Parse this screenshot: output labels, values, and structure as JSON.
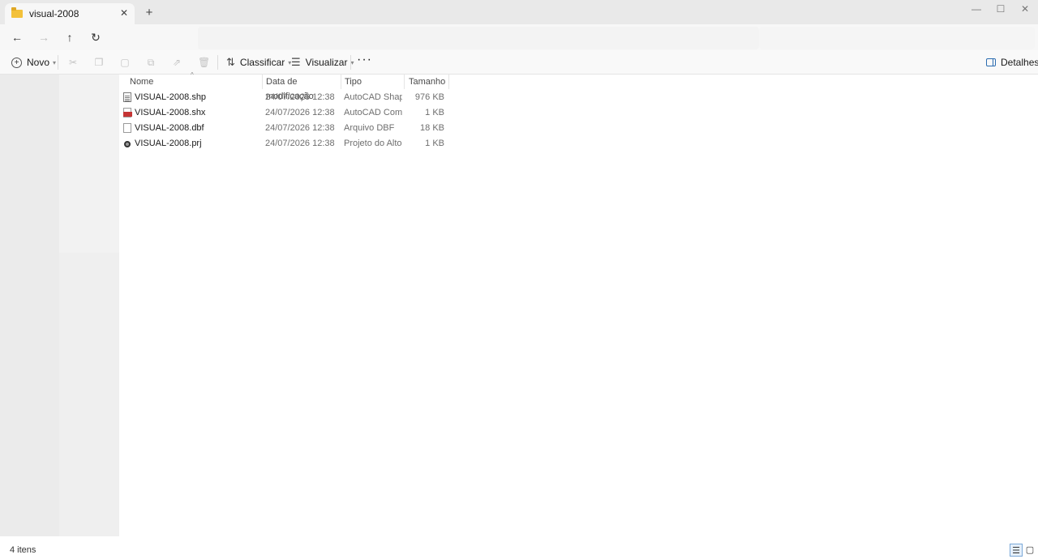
{
  "window": {
    "tab_title": "visual-2008"
  },
  "toolbar": {
    "new_label": "Novo",
    "sort_label": "Classificar",
    "view_label": "Visualizar",
    "details_label": "Detalhes"
  },
  "columns": {
    "name": "Nome",
    "date": "Data de modificação",
    "type": "Tipo",
    "size": "Tamanho"
  },
  "files": [
    {
      "name": "VISUAL-2008.shp",
      "date": "24/07/2026 12:38",
      "type": "AutoCAD Shape S...",
      "size": "976 KB",
      "icon": "document-lines-icon"
    },
    {
      "name": "VISUAL-2008.shx",
      "date": "24/07/2026 12:38",
      "type": "AutoCAD Compil...",
      "size": "1 KB",
      "icon": "autocad-shx-icon"
    },
    {
      "name": "VISUAL-2008.dbf",
      "date": "24/07/2026 12:38",
      "type": "Arquivo DBF",
      "size": "18 KB",
      "icon": "blank-file-icon"
    },
    {
      "name": "VISUAL-2008.prj",
      "date": "24/07/2026 12:38",
      "type": "Projeto do AltoQi ...",
      "size": "1 KB",
      "icon": "altoqi-project-icon"
    }
  ],
  "status": {
    "item_count": "4 itens"
  },
  "colors": {
    "accent": "#2b6cb0",
    "folder": "#f3c13a"
  }
}
